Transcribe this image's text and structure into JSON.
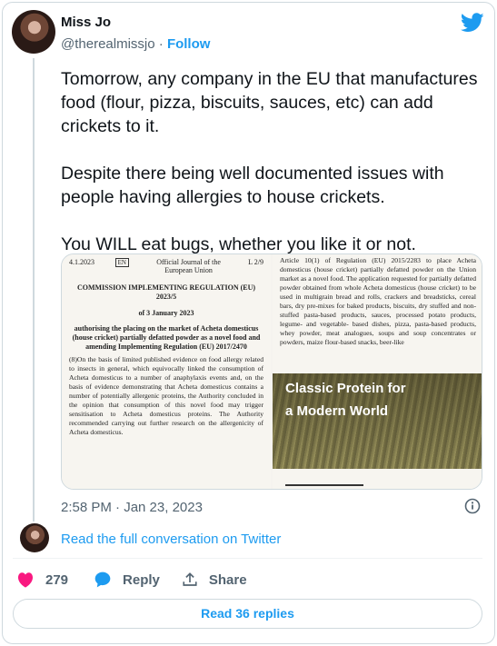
{
  "author": {
    "name": "Miss Jo",
    "handle": "@therealmissjo",
    "separator": "·",
    "follow_label": "Follow"
  },
  "tweet": {
    "paragraphs": [
      "Tomorrow, any company in the EU that manufactures food (flour, pizza, biscuits, sauces, etc) can add crickets to it.",
      "Despite there being well documented issues with people having allergies to house crickets.",
      "You WILL eat bugs, whether you like it or not."
    ],
    "timestamp": "2:58 PM · Jan 23, 2023"
  },
  "media": {
    "left_page": {
      "date": "4.1.2023",
      "lang": "EN",
      "journal": "Official Journal of the European Union",
      "page": "L 2/9",
      "title": "COMMISSION IMPLEMENTING REGULATION (EU) 2023/5",
      "date_line": "of 3 January 2023",
      "subtitle": "authorising the placing on the market of Acheta domesticus (house cricket) partially defatted powder as a novel food and amending Implementing Regulation (EU) 2017/2470",
      "body": "(8)On the basis of limited published evidence on food allergy related to insects in general, which equivocally linked the consumption of Acheta domesticus to a number of anaphylaxis events and, on the basis of evidence demonstrating that Acheta domesticus contains a number of potentially allergenic proteins, the Authority concluded in the opinion that consumption of this novel food may trigger sensitisation to Acheta domesticus proteins. The Authority recommended carrying out further research on the allergenicity of Acheta domesticus."
    },
    "right_page": {
      "body": "Article 10(1) of Regulation (EU) 2015/2283 to place Acheta domesticus (house cricket) partially defatted powder on the Union market as a novel food. The application requested for partially defatted powder obtained from whole Acheta domesticus (house cricket) to be used in multigrain bread and rolls, crackers and breadsticks, cereal bars, dry pre-mixes for baked products, biscuits, dry stuffed and non-stuffed pasta-based products, sauces, processed potato products, legume- and vegetable- based dishes, pizza, pasta-based products, whey powder, meat analogues, soups and soup concentrates or powders, maize flour-based snacks, beer-like"
    },
    "overlay": {
      "line1": "Classic Protein for",
      "line2": "a Modern World"
    }
  },
  "thread": {
    "read_conversation": "Read the full conversation on Twitter"
  },
  "actions": {
    "likes": "279",
    "reply_label": "Reply",
    "share_label": "Share"
  },
  "footer": {
    "read_replies": "Read 36 replies"
  },
  "colors": {
    "accent": "#1d9bf0",
    "like": "#f91880",
    "muted": "#536471"
  }
}
